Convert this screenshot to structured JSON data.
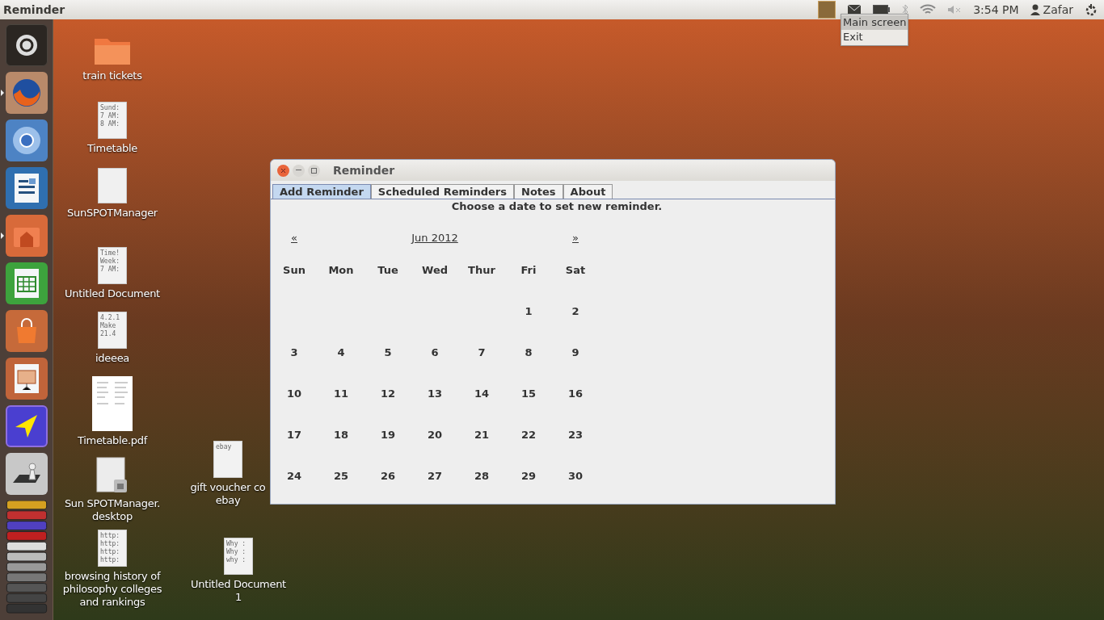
{
  "top_bar": {
    "title": "Reminder",
    "clock": "3:54 PM",
    "user": "Zafar"
  },
  "tray_menu": {
    "items": [
      {
        "label": "Main screen",
        "selected": true
      },
      {
        "label": "Exit",
        "selected": false
      }
    ]
  },
  "launcher": {
    "items": [
      {
        "kind": "dash",
        "running": false
      },
      {
        "kind": "firefox",
        "running": true
      },
      {
        "kind": "chromium",
        "running": false
      },
      {
        "kind": "writer",
        "running": false
      },
      {
        "kind": "home",
        "running": true
      },
      {
        "kind": "calc",
        "running": false
      },
      {
        "kind": "store",
        "running": false
      },
      {
        "kind": "impress",
        "running": false
      },
      {
        "kind": "arrow",
        "running": false
      },
      {
        "kind": "chess",
        "running": false
      }
    ]
  },
  "desktop_icons": [
    {
      "kind": "folder",
      "lines": [
        "train tickets"
      ]
    },
    {
      "kind": "text",
      "lines": [
        "Timetable"
      ],
      "preview": [
        "Sund:",
        "7 AM:",
        "8 AM:"
      ]
    },
    {
      "kind": "blank",
      "lines": [
        "SunSPOTManager"
      ]
    },
    {
      "kind": "text",
      "lines": [
        "Untitled Document"
      ],
      "preview": [
        "Time!",
        "Week:",
        "7 AM:"
      ]
    },
    {
      "kind": "text",
      "lines": [
        "ideeea"
      ],
      "preview": [
        "4.2.1",
        "Make",
        "21.4"
      ]
    },
    {
      "kind": "pdf",
      "lines": [
        "Timetable.pdf"
      ]
    },
    {
      "kind": "locked",
      "lines": [
        "Sun SPOTManager.",
        "desktop"
      ]
    },
    {
      "kind": "text",
      "lines": [
        "browsing history of",
        "philosophy colleges",
        "and rankings"
      ],
      "preview": [
        "http:",
        "http:",
        "http:",
        "http:"
      ]
    },
    {
      "kind": "text",
      "lines": [
        "gift voucher co",
        "ebay"
      ],
      "preview": [
        "ebay"
      ]
    },
    {
      "kind": "text",
      "lines": [
        "Untitled Document",
        "1"
      ],
      "preview": [
        "Why :",
        "Why :",
        "why :"
      ]
    }
  ],
  "window": {
    "title": "Reminder",
    "tabs": [
      {
        "label": "Add Reminder",
        "selected": true
      },
      {
        "label": "Scheduled Reminders",
        "selected": false
      },
      {
        "label": "Notes",
        "selected": false
      },
      {
        "label": "About",
        "selected": false
      }
    ],
    "instruction": "Choose a date to set new reminder.",
    "calendar": {
      "prev": "«",
      "month": "Jun 2012",
      "next": "»",
      "weekdays": [
        "Sun",
        "Mon",
        "Tue",
        "Wed",
        "Thur",
        "Fri",
        "Sat"
      ],
      "weeks": [
        [
          "1",
          "2"
        ],
        [
          "3",
          "4",
          "5",
          "6",
          "7",
          "8",
          "9"
        ],
        [
          "10",
          "11",
          "12",
          "13",
          "14",
          "15",
          "16"
        ],
        [
          "17",
          "18",
          "19",
          "20",
          "21",
          "22",
          "23"
        ],
        [
          "24",
          "25",
          "26",
          "27",
          "28",
          "29",
          "30"
        ]
      ]
    }
  }
}
